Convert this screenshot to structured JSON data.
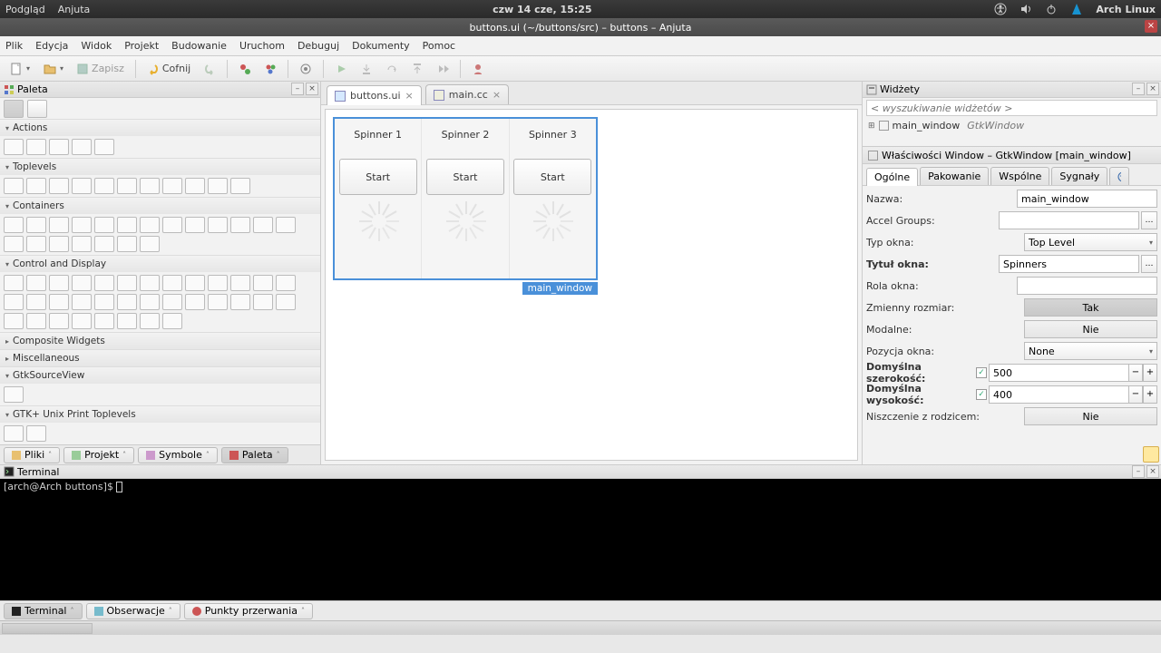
{
  "top_panel": {
    "left": [
      "Podgląd",
      "Anjuta"
    ],
    "center": "czw 14 cze, 15:25",
    "arch": "Arch Linux"
  },
  "window_title": "buttons.ui (~/buttons/src) – buttons – Anjuta",
  "menubar": [
    "Plik",
    "Edycja",
    "Widok",
    "Projekt",
    "Budowanie",
    "Uruchom",
    "Debuguj",
    "Dokumenty",
    "Pomoc"
  ],
  "toolbar": {
    "save": "Zapisz",
    "undo": "Cofnij"
  },
  "palette": {
    "title": "Paleta",
    "categories": {
      "actions": "Actions",
      "toplevels": "Toplevels",
      "containers": "Containers",
      "control": "Control and Display",
      "composite": "Composite Widgets",
      "misc": "Miscellaneous",
      "sourceview": "GtkSourceView",
      "print": "GTK+ Unix Print Toplevels"
    }
  },
  "bottom_left_tabs": [
    "Pliki",
    "Projekt",
    "Symbole",
    "Paleta"
  ],
  "editor_tabs": [
    {
      "name": "buttons.ui",
      "active": true
    },
    {
      "name": "main.cc",
      "active": false
    }
  ],
  "design": {
    "labels": [
      "Spinner 1",
      "Spinner 2",
      "Spinner 3"
    ],
    "button": "Start",
    "selection_tag": "main_window"
  },
  "widgets": {
    "title": "Widżety",
    "search_placeholder": "< wyszukiwanie widżetów >",
    "tree": {
      "name": "main_window",
      "type": "GtkWindow"
    },
    "props_title": "Właściwości Window – GtkWindow [main_window]",
    "tabs": [
      "Ogólne",
      "Pakowanie",
      "Wspólne",
      "Sygnały"
    ],
    "rows": {
      "name": {
        "label": "Nazwa:",
        "value": "main_window"
      },
      "accel": {
        "label": "Accel Groups:",
        "value": ""
      },
      "wtype": {
        "label": "Typ okna:",
        "value": "Top Level"
      },
      "title": {
        "label": "Tytuł okna:",
        "value": "Spinners"
      },
      "role": {
        "label": "Rola okna:",
        "value": ""
      },
      "resizable": {
        "label": "Zmienny rozmiar:",
        "value": "Tak"
      },
      "modal": {
        "label": "Modalne:",
        "value": "Nie"
      },
      "pos": {
        "label": "Pozycja okna:",
        "value": "None"
      },
      "defw": {
        "label": "Domyślna szerokość:",
        "value": "500"
      },
      "defh": {
        "label": "Domyślna wysokość:",
        "value": "400"
      },
      "destroy": {
        "label": "Niszczenie z rodzicem:",
        "value": "Nie"
      }
    }
  },
  "terminal": {
    "title": "Terminal",
    "prompt": "[arch@Arch buttons]$ "
  },
  "bottom_tabs": [
    "Terminal",
    "Obserwacje",
    "Punkty przerwania"
  ]
}
